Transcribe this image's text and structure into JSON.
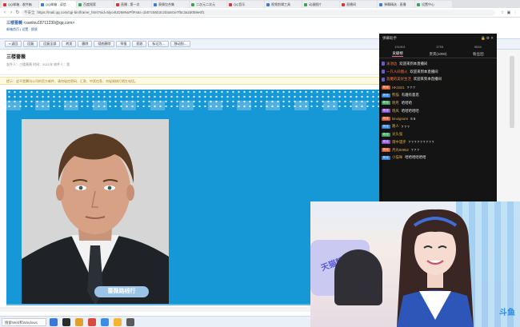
{
  "browser": {
    "tabs": [
      {
        "label": "QQ邮箱 - 收件箱",
        "active": false
      },
      {
        "label": "QQ邮箱 - 读信",
        "active": true
      },
      {
        "label": "百度搜索",
        "active": false
      },
      {
        "label": "直播 - 第一次",
        "active": false
      },
      {
        "label": "表情包合集",
        "active": false
      },
      {
        "label": "二次元二次元",
        "active": false
      },
      {
        "label": "QQ音乐",
        "active": false
      },
      {
        "label": "视频剪辑工具",
        "active": false
      },
      {
        "label": "动漫图片",
        "active": false
      },
      {
        "label": "直播间",
        "active": false
      },
      {
        "label": "弹幕精选 - 直播",
        "active": false
      },
      {
        "label": "设置中心",
        "active": false
      }
    ],
    "insecure_label": "不安全",
    "url": "https://mail.qq.com/cgi-bin/frame_html?sid=5lyo4UDIMNuPfiFs&r=1b07c66b3c2d4a91e7f5c3a2d0b9e6f1"
  },
  "mail": {
    "account_name": "三楼蔷薇",
    "account_email": "<sanlou18711230@qq.com>",
    "links": "邮箱首页 | 设置 - 换肤",
    "toolbar": [
      "« 返回",
      "回复",
      "回复全部",
      "转发",
      "删除",
      "彻底删除",
      "举报",
      "拒收",
      "标记为...",
      "移动到..."
    ],
    "subject": "三楼蔷薇",
    "meta": "发件人：三楼蔷薇   时间：2021年   收件人：我",
    "notice": "提示：这不是腾讯公司的官方邮件，请勿轻信密码、汇款、中奖信息，勿轻易拨打陌生电话。",
    "caption": "蔷薇路线行"
  },
  "chat": {
    "title": "弹幕助手",
    "stats": [
      "191901",
      "3793",
      "9534"
    ],
    "tabs": [
      "贡献榜",
      "贵宾(1000)",
      "粉丝团"
    ],
    "messages": [
      {
        "badge": "",
        "nick": "泳池边",
        "text": "欢迎来到本直播间",
        "welcome": true
      },
      {
        "badge": "",
        "nick": "一只人间烟火",
        "text": "欢迎来到本直播间",
        "welcome": true
      },
      {
        "badge": "",
        "nick": "恶魔的美好生活",
        "text": "欢迎来到本直播间",
        "welcome": true
      },
      {
        "badge": "粉丝",
        "nick": "HK3321",
        "text": "? ? ?",
        "welcome": false
      },
      {
        "badge": "粉丝",
        "nick": "熊猫",
        "text": "有趣有意思",
        "welcome": false
      },
      {
        "badge": "粉丝",
        "nick": "明月",
        "text": "哈哈哈",
        "welcome": false
      },
      {
        "badge": "粉丝",
        "nick": "晓风",
        "text": "哈哈哈哈哈",
        "welcome": false
      },
      {
        "badge": "粉丝",
        "nick": "kinoignore",
        "text": "6 6",
        "welcome": false
      },
      {
        "badge": "粉丝",
        "nick": "路人",
        "text": "? ? ?",
        "welcome": false
      },
      {
        "badge": "粉丝",
        "nick": "光头强",
        "text": "",
        "welcome": false
      },
      {
        "badge": "粉丝",
        "nick": "雨中漫步",
        "text": "? ? ? ? ? ? ? ? ?",
        "welcome": false
      },
      {
        "badge": "粉丝",
        "nick": "月光50952",
        "text": "? ? ?",
        "welcome": false
      },
      {
        "badge": "粉丝",
        "nick": "小猫咪",
        "text": "哈哈哈哈哈哈",
        "welcome": false
      }
    ]
  },
  "cam": {
    "pillow_text": "天猫精选",
    "logo": "斗鱼"
  },
  "taskbar": {
    "search": "搜索Web和Windows"
  }
}
